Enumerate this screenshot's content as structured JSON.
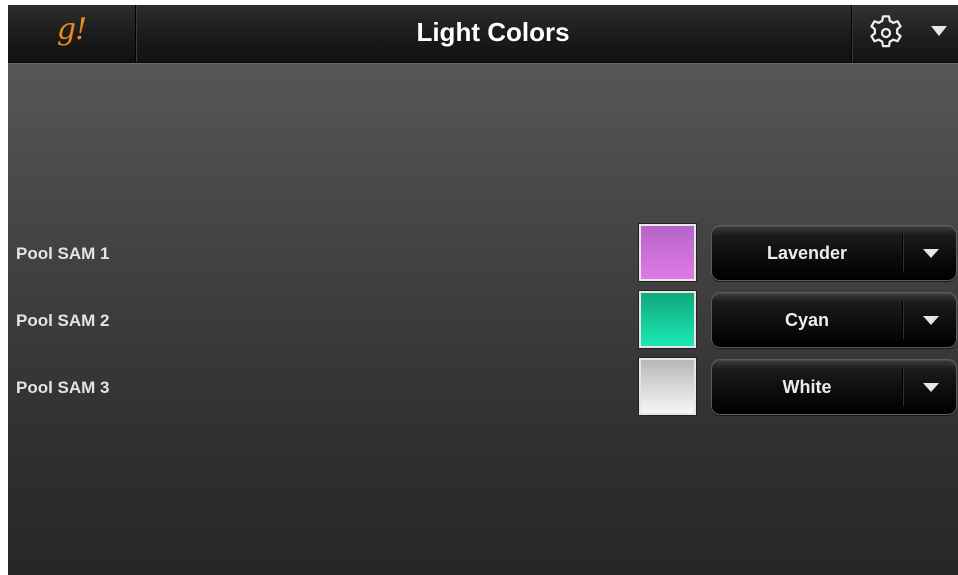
{
  "header": {
    "logo_text": "g!",
    "title": "Light Colors",
    "settings_icon": "gear-icon",
    "menu_icon": "caret-down-icon"
  },
  "lights": [
    {
      "label": "Pool SAM 1",
      "color_name": "Lavender",
      "swatch_top": "#b564c8",
      "swatch_bottom": "#e07ae8"
    },
    {
      "label": "Pool SAM 2",
      "color_name": "Cyan",
      "swatch_top": "#0fa87c",
      "swatch_bottom": "#1ee8b4"
    },
    {
      "label": "Pool SAM 3",
      "color_name": "White",
      "swatch_top": "#b8b8b8",
      "swatch_bottom": "#f6f6f6"
    }
  ],
  "colors": {
    "logo": "#e88a1e",
    "header_bg": "#1b1b1b",
    "body_top": "#5d5d5d",
    "body_bottom": "#262626"
  }
}
